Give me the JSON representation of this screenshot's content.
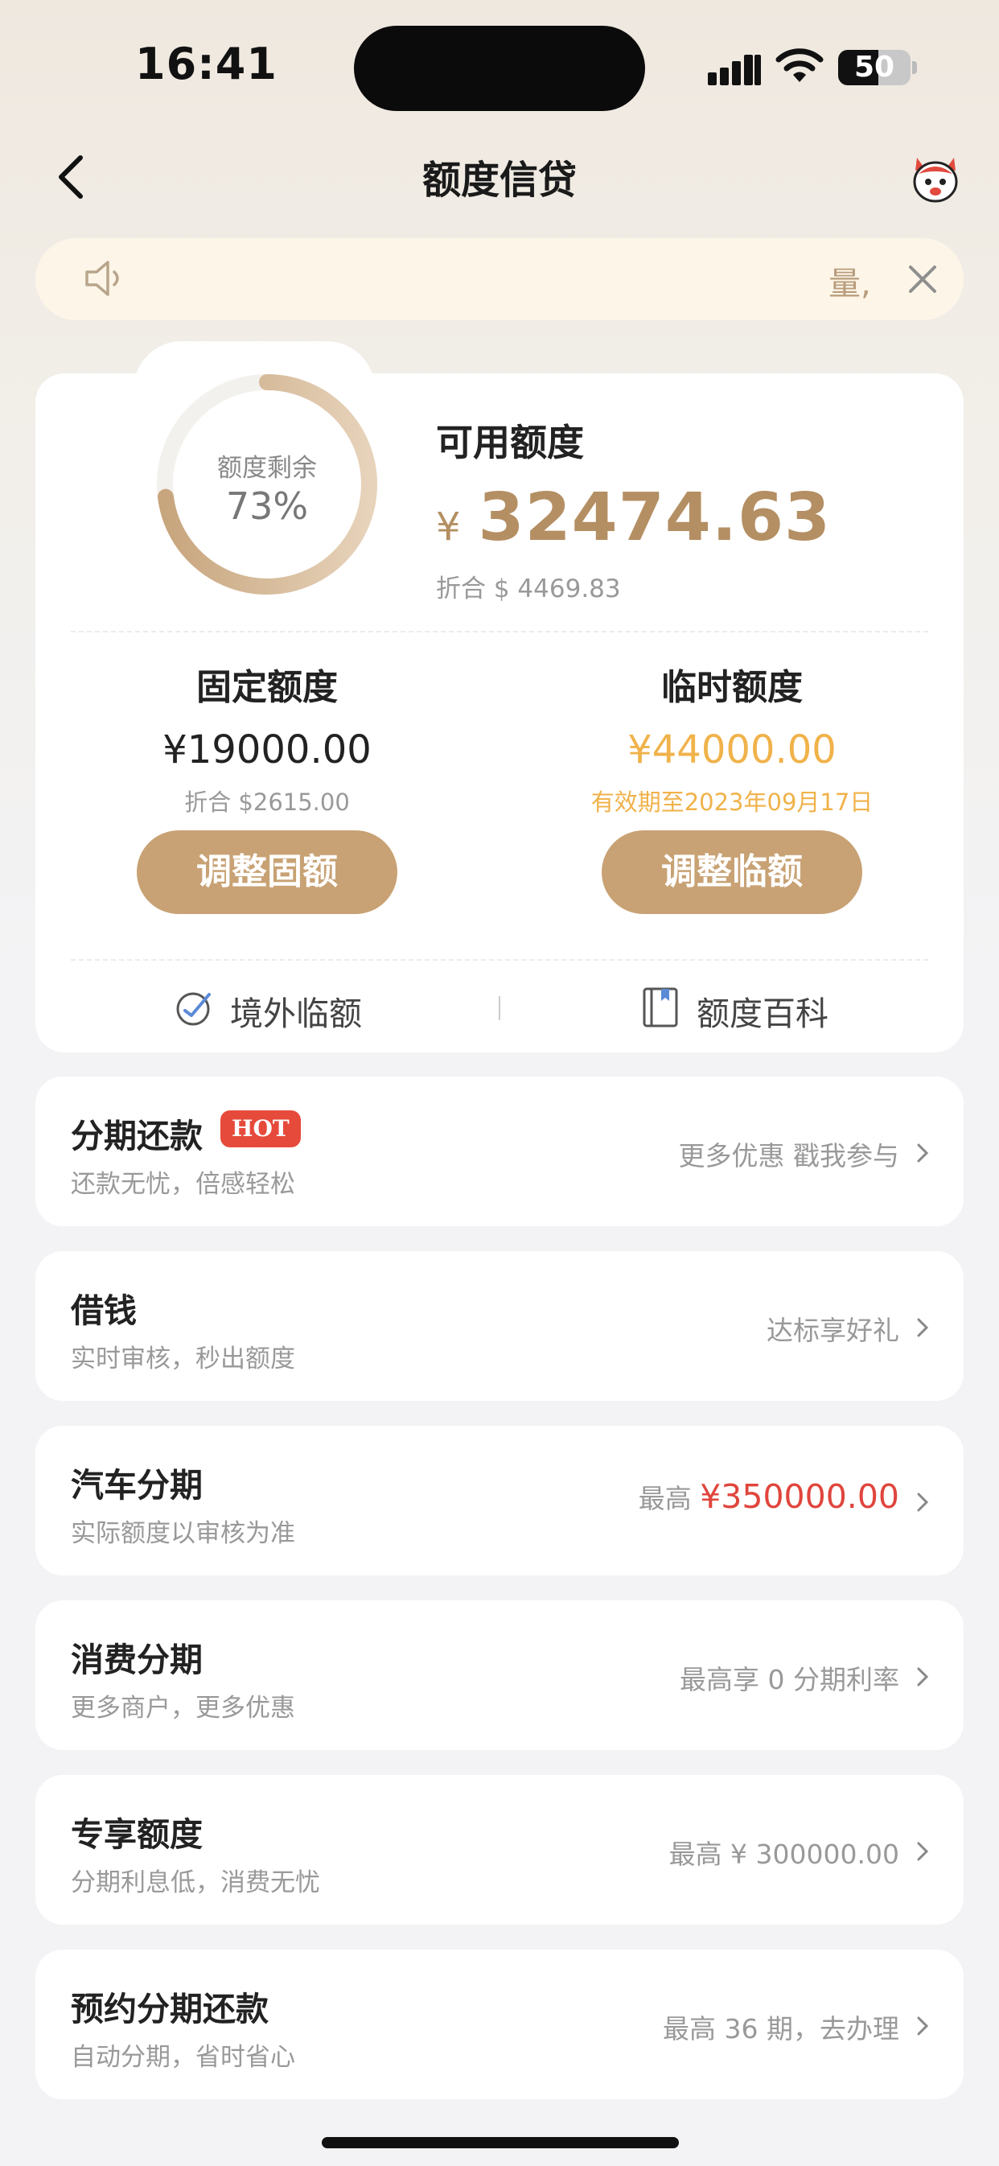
{
  "status_bar": {
    "time": "16:41",
    "battery": "50"
  },
  "nav": {
    "title": "额度信贷"
  },
  "notice": {
    "marquee_text": "量,"
  },
  "credit": {
    "ring_label": "额度剩余",
    "ring_percent": "73%",
    "ring_fraction": 0.73,
    "available_label": "可用额度",
    "available_currency": "¥",
    "available_amount": "32474.63",
    "available_usd": "折合 $ 4469.83",
    "fixed": {
      "label": "固定额度",
      "amount": "¥19000.00",
      "sub": "折合 $2615.00",
      "button": "调整固额"
    },
    "temporary": {
      "label": "临时额度",
      "amount": "¥44000.00",
      "sub": "有效期至2023年09月17日",
      "button": "调整临额"
    },
    "links": [
      {
        "label": "境外临额",
        "icon": "overseas-icon"
      },
      {
        "label": "额度百科",
        "icon": "book-icon"
      }
    ]
  },
  "services": [
    {
      "title": "分期还款",
      "badge": "HOT",
      "subtitle": "还款无忧，倍感轻松",
      "right": "更多优惠 戳我参与",
      "right_prefix": "",
      "right_highlight": ""
    },
    {
      "title": "借钱",
      "badge": "",
      "subtitle": "实时审核，秒出额度",
      "right": "达标享好礼",
      "right_prefix": "",
      "right_highlight": ""
    },
    {
      "title": "汽车分期",
      "badge": "",
      "subtitle": "实际额度以审核为准",
      "right": "",
      "right_prefix": "最高",
      "right_highlight": "¥350000.00"
    },
    {
      "title": "消费分期",
      "badge": "",
      "subtitle": "更多商户，更多优惠",
      "right": "最高享 0 分期利率",
      "right_prefix": "",
      "right_highlight": ""
    },
    {
      "title": "专享额度",
      "badge": "",
      "subtitle": "分期利息低，消费无忧",
      "right": "最高 ¥ 300000.00",
      "right_prefix": "",
      "right_highlight": ""
    },
    {
      "title": "预约分期还款",
      "badge": "",
      "subtitle": "自动分期，省时省心",
      "right": "最高 36 期，去办理",
      "right_prefix": "",
      "right_highlight": ""
    }
  ],
  "colors": {
    "accent_gold": "#c8a274",
    "temp_amount": "#f0b24a",
    "hot_badge": "#e64a3b",
    "highlight_red": "#e0453c"
  }
}
